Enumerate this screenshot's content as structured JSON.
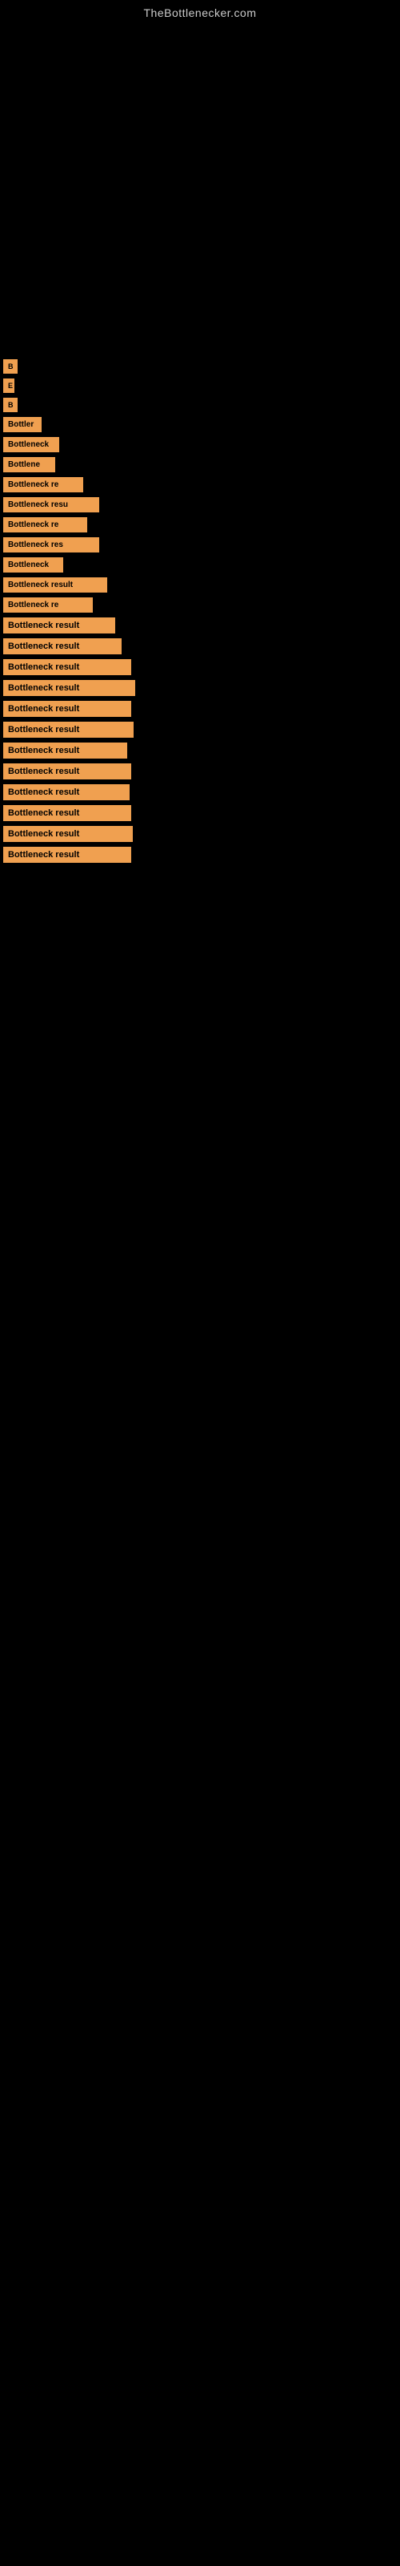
{
  "header": {
    "site_title": "TheBottlenecker.com"
  },
  "items": [
    {
      "id": 1,
      "label": "B"
    },
    {
      "id": 2,
      "label": "E"
    },
    {
      "id": 3,
      "label": "B"
    },
    {
      "id": 4,
      "label": "Bottler"
    },
    {
      "id": 5,
      "label": "Bottleneck"
    },
    {
      "id": 6,
      "label": "Bottlene"
    },
    {
      "id": 7,
      "label": "Bottleneck re"
    },
    {
      "id": 8,
      "label": "Bottleneck resu"
    },
    {
      "id": 9,
      "label": "Bottleneck re"
    },
    {
      "id": 10,
      "label": "Bottleneck res"
    },
    {
      "id": 11,
      "label": "Bottleneck"
    },
    {
      "id": 12,
      "label": "Bottleneck result"
    },
    {
      "id": 13,
      "label": "Bottleneck re"
    },
    {
      "id": 14,
      "label": "Bottleneck result"
    },
    {
      "id": 15,
      "label": "Bottleneck result"
    },
    {
      "id": 16,
      "label": "Bottleneck result"
    },
    {
      "id": 17,
      "label": "Bottleneck result"
    },
    {
      "id": 18,
      "label": "Bottleneck result"
    },
    {
      "id": 19,
      "label": "Bottleneck result"
    },
    {
      "id": 20,
      "label": "Bottleneck result"
    },
    {
      "id": 21,
      "label": "Bottleneck result"
    },
    {
      "id": 22,
      "label": "Bottleneck result"
    },
    {
      "id": 23,
      "label": "Bottleneck result"
    },
    {
      "id": 24,
      "label": "Bottleneck result"
    },
    {
      "id": 25,
      "label": "Bottleneck result"
    }
  ]
}
